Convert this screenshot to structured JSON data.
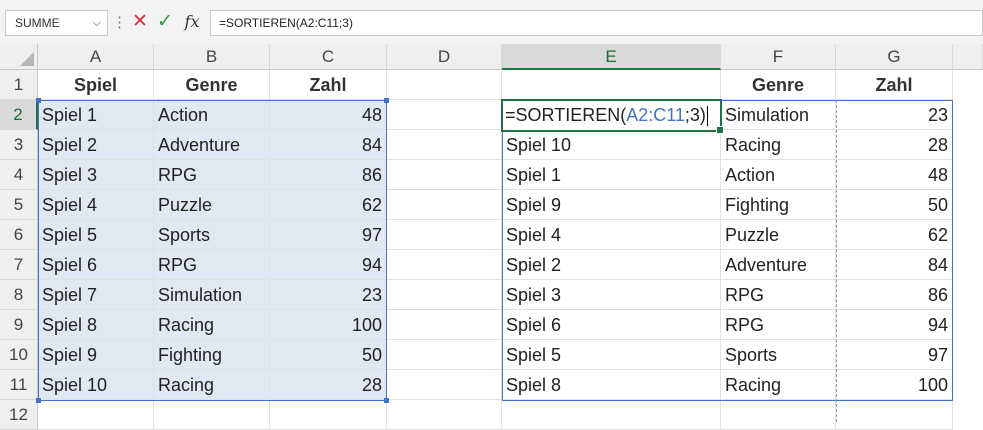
{
  "formula_bar": {
    "name_box": "SUMME",
    "name_box_arrow": "⌵",
    "more_dots": "⋮",
    "cancel_icon": "✕",
    "enter_icon": "✓",
    "fx_icon": "fx",
    "formula": "=SORTIEREN(A2:C11;3)"
  },
  "columns": [
    "A",
    "B",
    "C",
    "D",
    "E",
    "F",
    "G"
  ],
  "rows": [
    "1",
    "2",
    "3",
    "4",
    "5",
    "6",
    "7",
    "8",
    "9",
    "10",
    "11",
    "12"
  ],
  "source_table": {
    "headers": [
      "Spiel",
      "Genre",
      "Zahl"
    ],
    "rows": [
      [
        "Spiel 1",
        "Action",
        "48"
      ],
      [
        "Spiel 2",
        "Adventure",
        "84"
      ],
      [
        "Spiel 3",
        "RPG",
        "86"
      ],
      [
        "Spiel 4",
        "Puzzle",
        "62"
      ],
      [
        "Spiel 5",
        "Sports",
        "97"
      ],
      [
        "Spiel 6",
        "RPG",
        "94"
      ],
      [
        "Spiel 7",
        "Simulation",
        "23"
      ],
      [
        "Spiel 8",
        "Racing",
        "100"
      ],
      [
        "Spiel 9",
        "Fighting",
        "50"
      ],
      [
        "Spiel 10",
        "Racing",
        "28"
      ]
    ]
  },
  "result_table": {
    "headers": [
      "",
      "Genre",
      "Zahl"
    ],
    "editing_formula": {
      "prefix": "=SORTIEREN(",
      "ref": "A2:C11",
      "suffix": ";3)"
    },
    "rows": [
      [
        "",
        "Simulation",
        "23"
      ],
      [
        "Spiel 10",
        "Racing",
        "28"
      ],
      [
        "Spiel 1",
        "Action",
        "48"
      ],
      [
        "Spiel 9",
        "Fighting",
        "50"
      ],
      [
        "Spiel 4",
        "Puzzle",
        "62"
      ],
      [
        "Spiel 2",
        "Adventure",
        "84"
      ],
      [
        "Spiel 3",
        "RPG",
        "86"
      ],
      [
        "Spiel 6",
        "RPG",
        "94"
      ],
      [
        "Spiel 5",
        "Sports",
        "97"
      ],
      [
        "Spiel 8",
        "Racing",
        "100"
      ]
    ]
  },
  "colors": {
    "accent": "#217346",
    "range_border": "#4472c4",
    "range_fill": "#e1e7f3"
  }
}
